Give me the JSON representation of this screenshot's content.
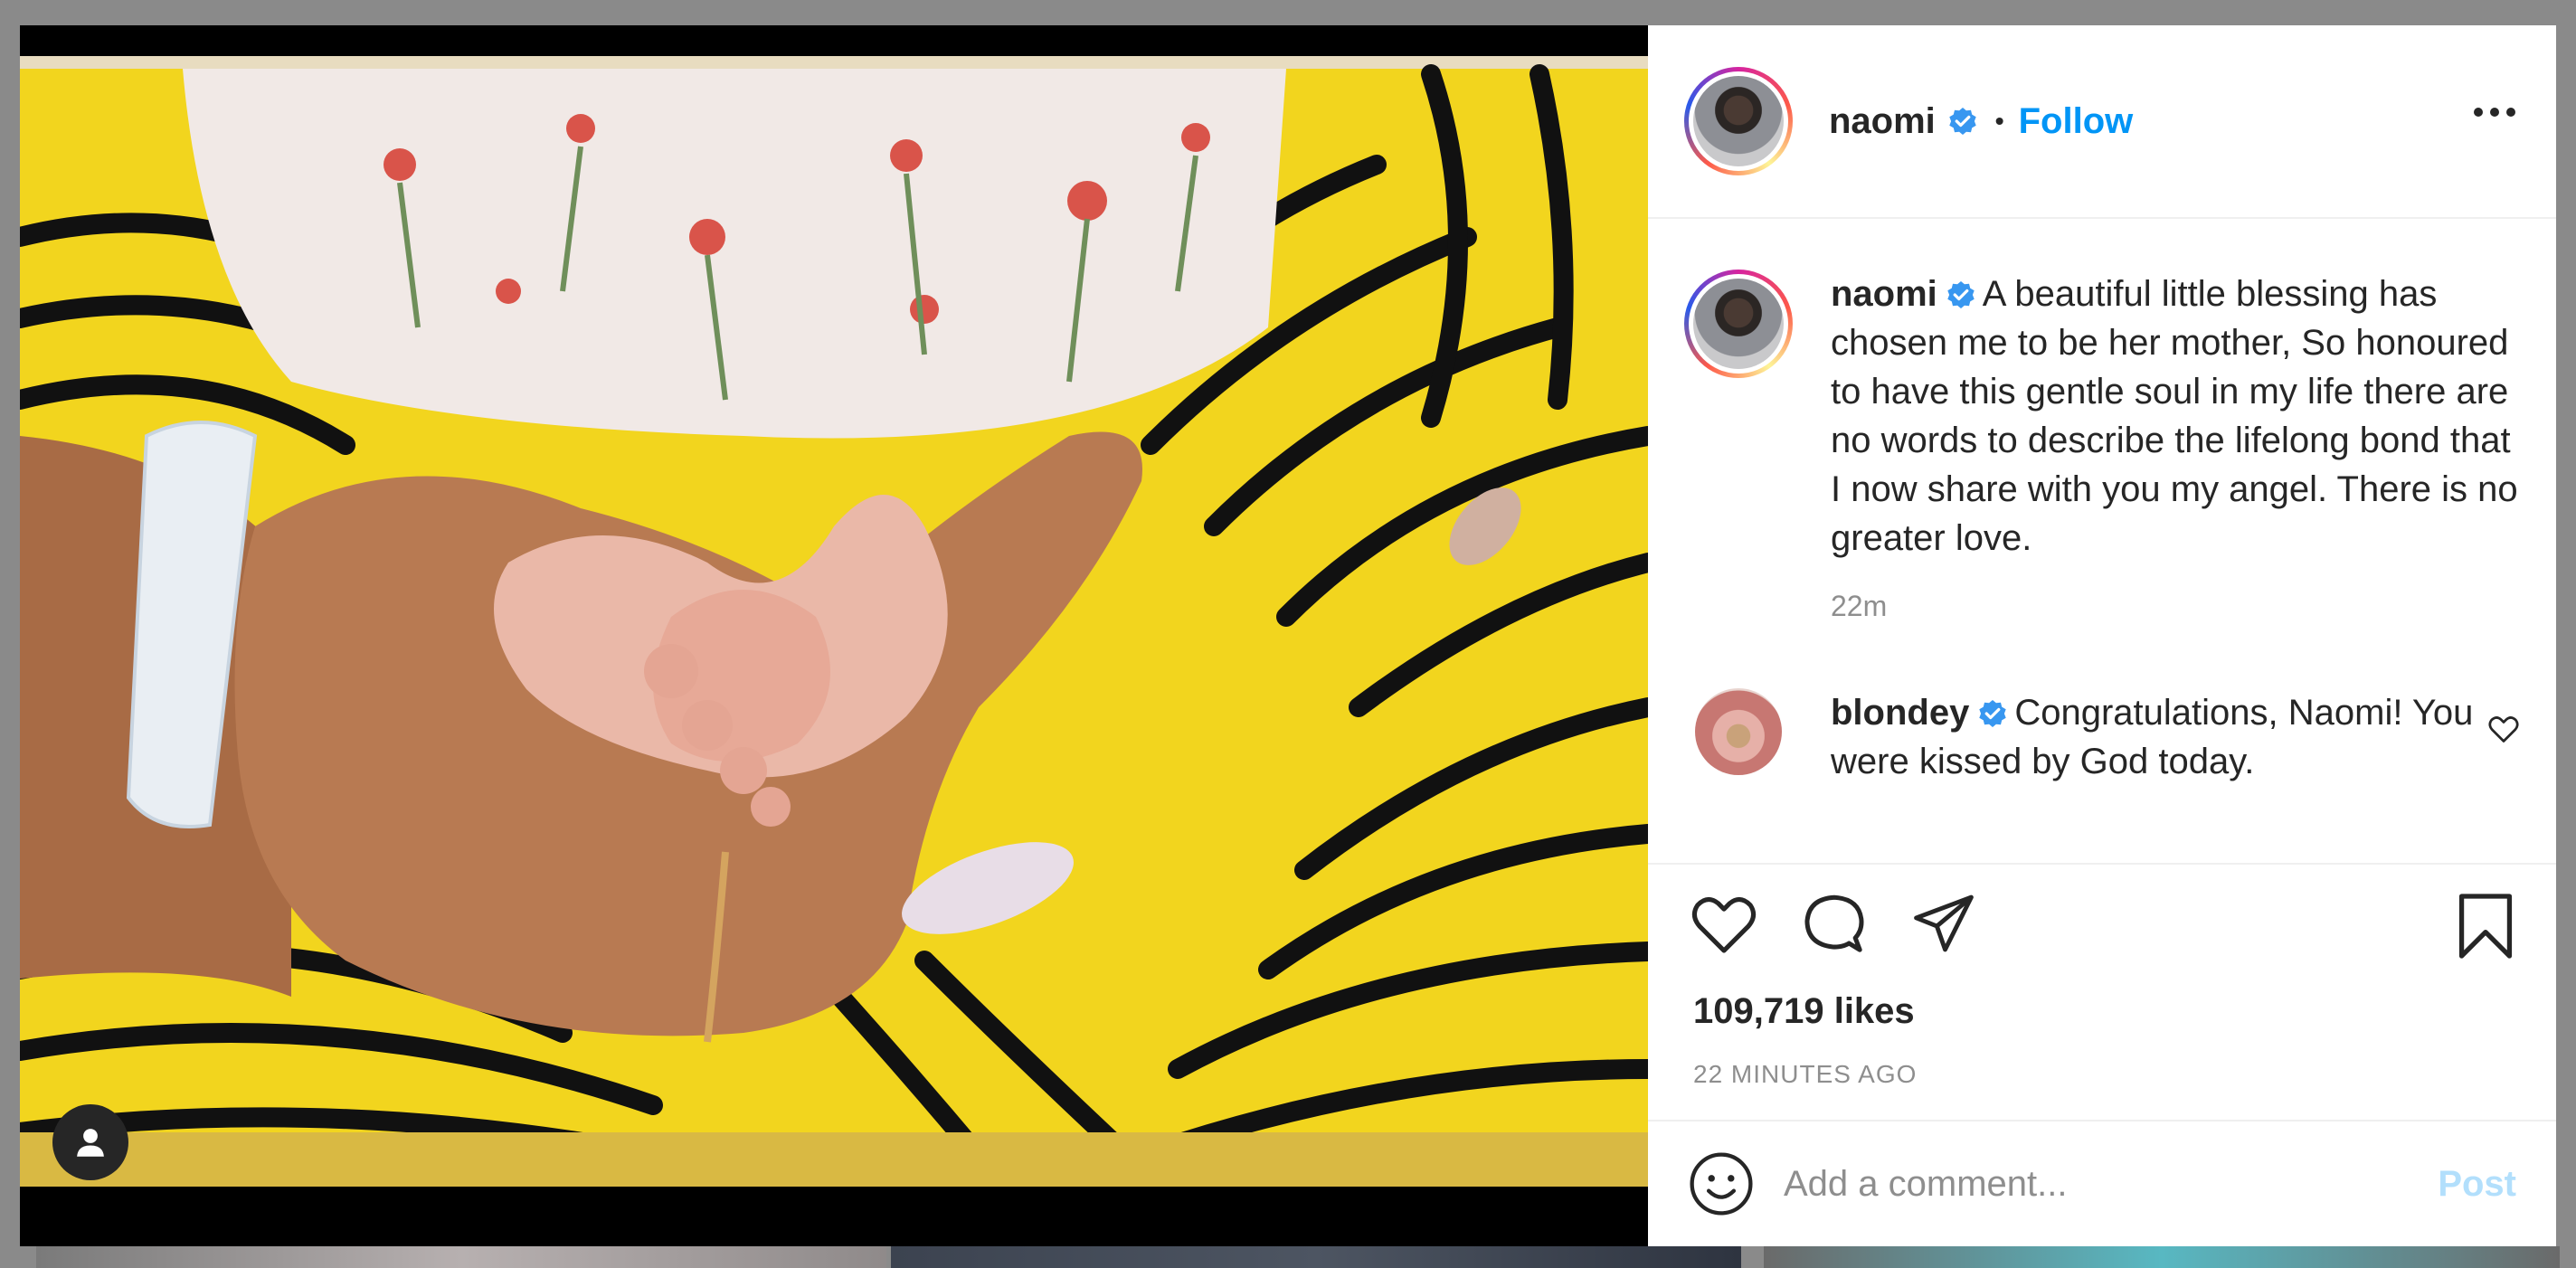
{
  "post": {
    "author": "naomi",
    "separator": "•",
    "follow_label": "Follow",
    "caption_author": "naomi",
    "caption": "A beautiful little blessing has chosen me to be her mother, So honoured to have this gentle soul in my life there are no words to describe the lifelong bond that I now share with you my angel. There is no greater love.",
    "caption_time": "22m",
    "likes": "109,719 likes",
    "posted": "22 MINUTES AGO"
  },
  "comments": [
    {
      "user": "blondey",
      "text": "Congratulations, Naomi! You were kissed by God today."
    }
  ],
  "composer": {
    "placeholder": "Add a comment...",
    "post_label": "Post"
  },
  "icons": {
    "verified": "verified-badge-icon",
    "more": "more-options-icon",
    "like": "heart-icon",
    "comment": "comment-icon",
    "share": "paper-plane-icon",
    "save": "bookmark-icon",
    "emoji": "emoji-icon",
    "tag": "user-tag-icon"
  },
  "colors": {
    "accent": "#0095f6",
    "verified": "#3897f0",
    "muted": "#8e8e8e",
    "post_disabled": "#b2dffc"
  }
}
